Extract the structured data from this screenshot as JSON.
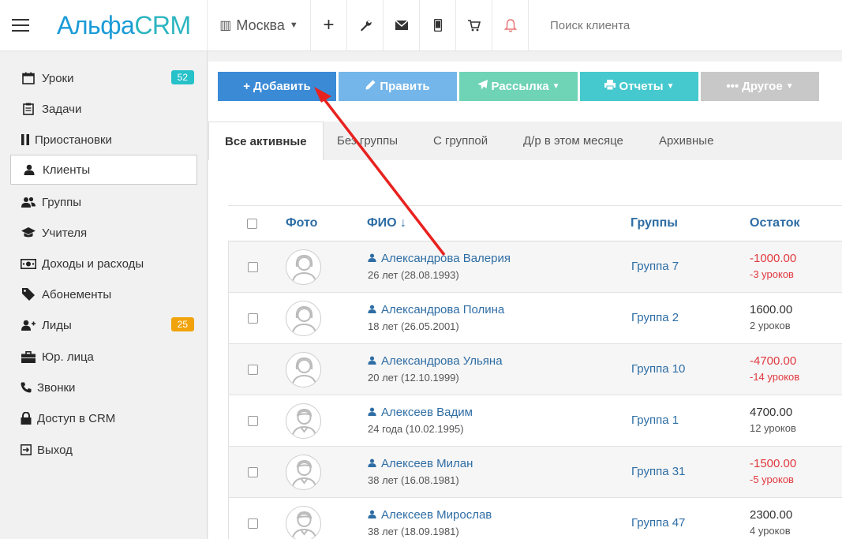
{
  "topbar": {
    "logo_main": "Альфа",
    "logo_crm": "CRM",
    "city": "Москва",
    "search_placeholder": "Поиск клиента"
  },
  "sidebar": {
    "items": [
      {
        "label": "Уроки",
        "badge": "52",
        "icon": "calendar-icon"
      },
      {
        "label": "Задачи",
        "icon": "clipboard-icon"
      },
      {
        "label": "Приостановки",
        "icon": "pause-icon"
      },
      {
        "label": "Клиенты",
        "icon": "user-icon"
      },
      {
        "label": "Группы",
        "icon": "users-icon"
      },
      {
        "label": "Учителя",
        "icon": "graduation-cap-icon"
      },
      {
        "label": "Доходы и расходы",
        "icon": "money-icon"
      },
      {
        "label": "Абонементы",
        "icon": "tag-icon"
      },
      {
        "label": "Лиды",
        "badge": "25",
        "icon": "user-plus-icon"
      },
      {
        "label": "Юр. лица",
        "icon": "briefcase-icon"
      },
      {
        "label": "Звонки",
        "icon": "phone-icon"
      },
      {
        "label": "Доступ в CRM",
        "icon": "lock-icon"
      },
      {
        "label": "Выход",
        "icon": "sign-out-icon"
      }
    ]
  },
  "toolbar": {
    "add": "Добавить",
    "edit": "Править",
    "mailing": "Рассылка",
    "reports": "Отчеты",
    "other": "Другое"
  },
  "tabs": [
    "Все активные",
    "Без группы",
    "С группой",
    "Д/р в этом месяце",
    "Архивные"
  ],
  "table": {
    "headers": {
      "photo": "Фото",
      "name": "ФИО ↓",
      "groups": "Группы",
      "balance": "Остаток"
    },
    "rows": [
      {
        "name": "Александрова Валерия",
        "age": "26 лет (28.08.1993)",
        "group": "Группа 7",
        "balance": "-1000.00",
        "lessons": "-3 уроков",
        "negative": true,
        "gender": "f"
      },
      {
        "name": "Александрова Полина",
        "age": "18 лет (26.05.2001)",
        "group": "Группа 2",
        "balance": "1600.00",
        "lessons": "2 уроков",
        "negative": false,
        "gender": "f"
      },
      {
        "name": "Александрова Ульяна",
        "age": "20 лет (12.10.1999)",
        "group": "Группа 10",
        "balance": "-4700.00",
        "lessons": "-14 уроков",
        "negative": true,
        "gender": "f"
      },
      {
        "name": "Алексеев Вадим",
        "age": "24 года (10.02.1995)",
        "group": "Группа 1",
        "balance": "4700.00",
        "lessons": "12 уроков",
        "negative": false,
        "gender": "m"
      },
      {
        "name": "Алексеев Милан",
        "age": "38 лет (16.08.1981)",
        "group": "Группа 31",
        "balance": "-1500.00",
        "lessons": "-5 уроков",
        "negative": true,
        "gender": "m"
      },
      {
        "name": "Алексеев Мирослав",
        "age": "38 лет (18.09.1981)",
        "group": "Группа 47",
        "balance": "2300.00",
        "lessons": "4 уроков",
        "negative": false,
        "gender": "m"
      }
    ]
  },
  "colors": {
    "annotation_arrow": "#e8221f",
    "accent": "#3a8ad6",
    "negative": "#e0393f"
  }
}
